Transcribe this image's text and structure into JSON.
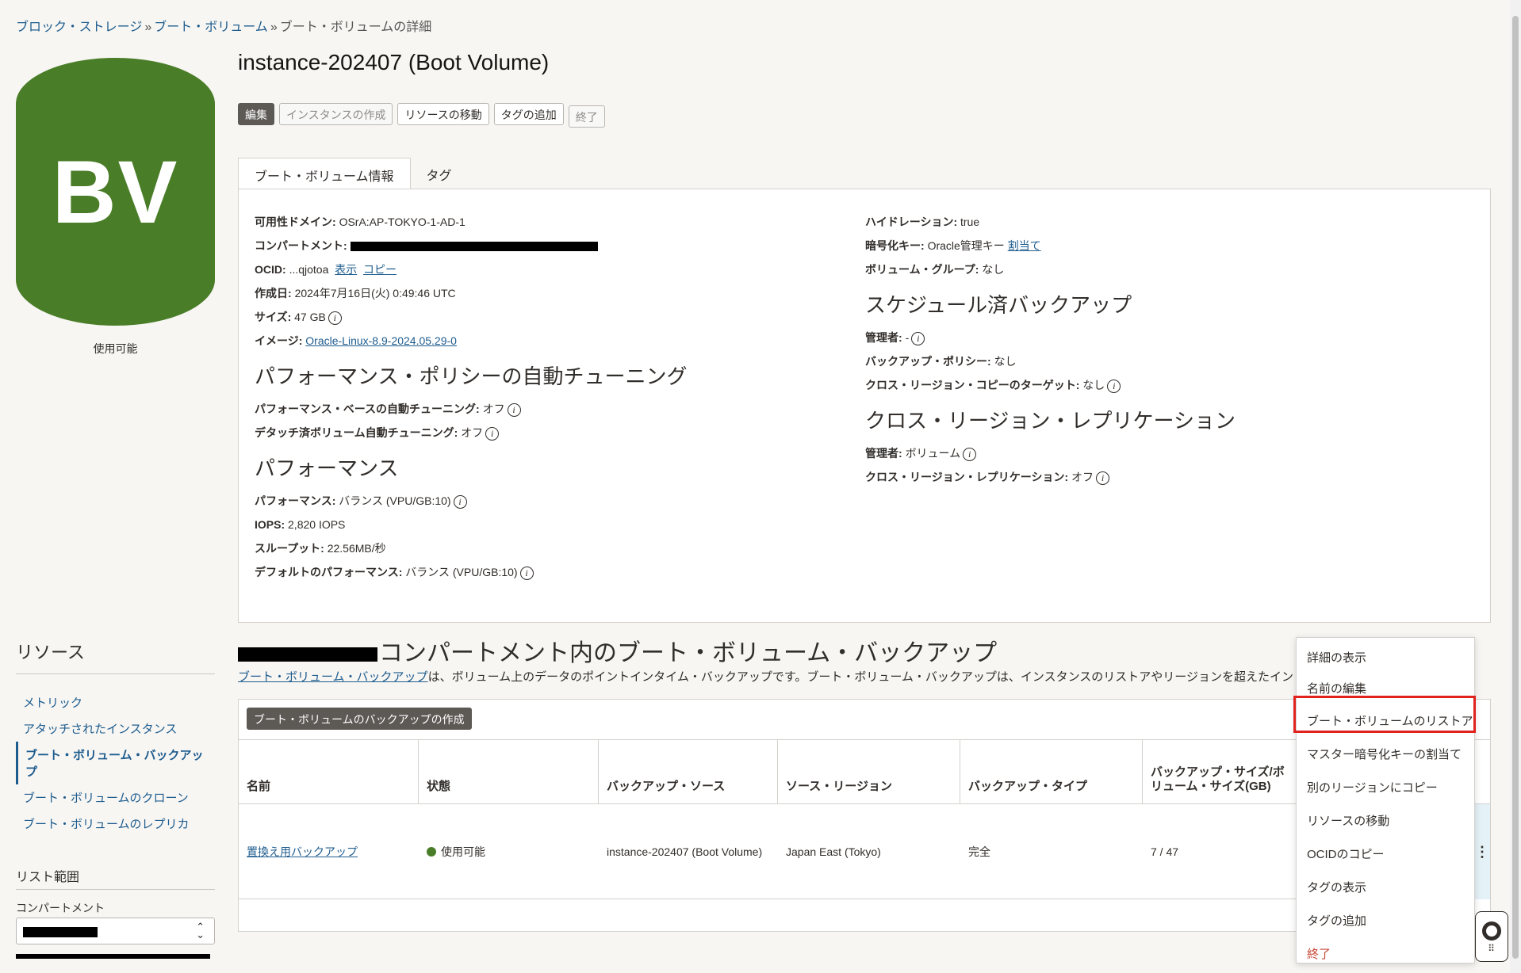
{
  "breadcrumb": {
    "items": [
      "ブロック・ストレージ",
      "ブート・ボリューム"
    ],
    "current": "ブート・ボリュームの詳細"
  },
  "badge": {
    "initials": "BV",
    "status": "使用可能",
    "color": "#4a7d28"
  },
  "title": "instance-202407 (Boot Volume)",
  "actions": {
    "edit": "編集",
    "create_instance": "インスタンスの作成",
    "move_resource": "リソースの移動",
    "add_tag": "タグの追加",
    "terminate": "終了"
  },
  "tabs": {
    "info": "ブート・ボリューム情報",
    "tags": "タグ"
  },
  "info": {
    "availability_domain_label": "可用性ドメイン:",
    "availability_domain": "OSrA:AP-TOKYO-1-AD-1",
    "compartment_label": "コンパートメント:",
    "ocid_label": "OCID:",
    "ocid_value": "...qjotoa",
    "ocid_show": "表示",
    "ocid_copy": "コピー",
    "created_label": "作成日:",
    "created": "2024年7月16日(火) 0:49:46 UTC",
    "size_label": "サイズ:",
    "size": "47 GB",
    "image_label": "イメージ:",
    "image": "Oracle-Linux-8.9-2024.05.29-0",
    "hydration_label": "ハイドレーション:",
    "hydration": "true",
    "encryption_label": "暗号化キー:",
    "encryption": "Oracle管理キー",
    "encryption_assign": "割当て",
    "volume_group_label": "ボリューム・グループ:",
    "volume_group": "なし"
  },
  "autotune": {
    "heading": "パフォーマンス・ポリシーの自動チューニング",
    "perf_based_label": "パフォーマンス・ベースの自動チューニング:",
    "perf_based": "オフ",
    "detached_label": "デタッチ済ボリューム自動チューニング:",
    "detached": "オフ"
  },
  "performance": {
    "heading": "パフォーマンス",
    "perf_label": "パフォーマンス:",
    "perf": "バランス (VPU/GB:10)",
    "iops_label": "IOPS:",
    "iops": "2,820 IOPS",
    "throughput_label": "スループット:",
    "throughput": "22.56MB/秒",
    "default_label": "デフォルトのパフォーマンス:",
    "default": "バランス (VPU/GB:10)"
  },
  "scheduled_backups": {
    "heading": "スケジュール済バックアップ",
    "manager_label": "管理者:",
    "manager": "-",
    "policy_label": "バックアップ・ポリシー:",
    "policy": "なし",
    "cross_target_label": "クロス・リージョン・コピーのターゲット:",
    "cross_target": "なし"
  },
  "replication": {
    "heading": "クロス・リージョン・レプリケーション",
    "manager_label": "管理者:",
    "manager": "ボリューム",
    "replication_label": "クロス・リージョン・レプリケーション:",
    "replication": "オフ"
  },
  "resources": {
    "title": "リソース",
    "items": [
      "メトリック",
      "アタッチされたインスタンス",
      "ブート・ボリューム・バックアップ",
      "ブート・ボリュームのクローン",
      "ブート・ボリュームのレプリカ"
    ],
    "scope_title": "リスト範囲",
    "compartment_label": "コンパートメント"
  },
  "backups": {
    "title": "コンパートメント内のブート・ボリューム・バックアップ",
    "desc_link": "ブート・ボリューム・バックアップ",
    "desc_rest": "は、ボリューム上のデータのポイントインタイム・バックアップです。ブート・ボリューム・バックアップは、インスタンスのリストアやリージョンを超えたインスタンスの移行",
    "create_button": "ブート・ボリュームのバックアップの作成",
    "columns": [
      "名前",
      "状態",
      "バックアップ・ソース",
      "ソース・リージョン",
      "バックアップ・タイプ",
      "バックアップ・サイズ/ボリューム・サイズ(GB)"
    ],
    "rows": [
      {
        "name": "置換え用バックアップ",
        "status": "使用可能",
        "source": "instance-202407 (Boot Volume)",
        "region": "Japan East (Tokyo)",
        "type": "完全",
        "size": "7 / 47"
      }
    ]
  },
  "context_menu": {
    "items": [
      "詳細の表示",
      "名前の編集",
      "ブート・ボリュームのリストア",
      "マスター暗号化キーの割当て",
      "別のリージョンにコピー",
      "リソースの移動",
      "OCIDのコピー",
      "タグの表示",
      "タグの追加"
    ],
    "danger": "終了"
  }
}
